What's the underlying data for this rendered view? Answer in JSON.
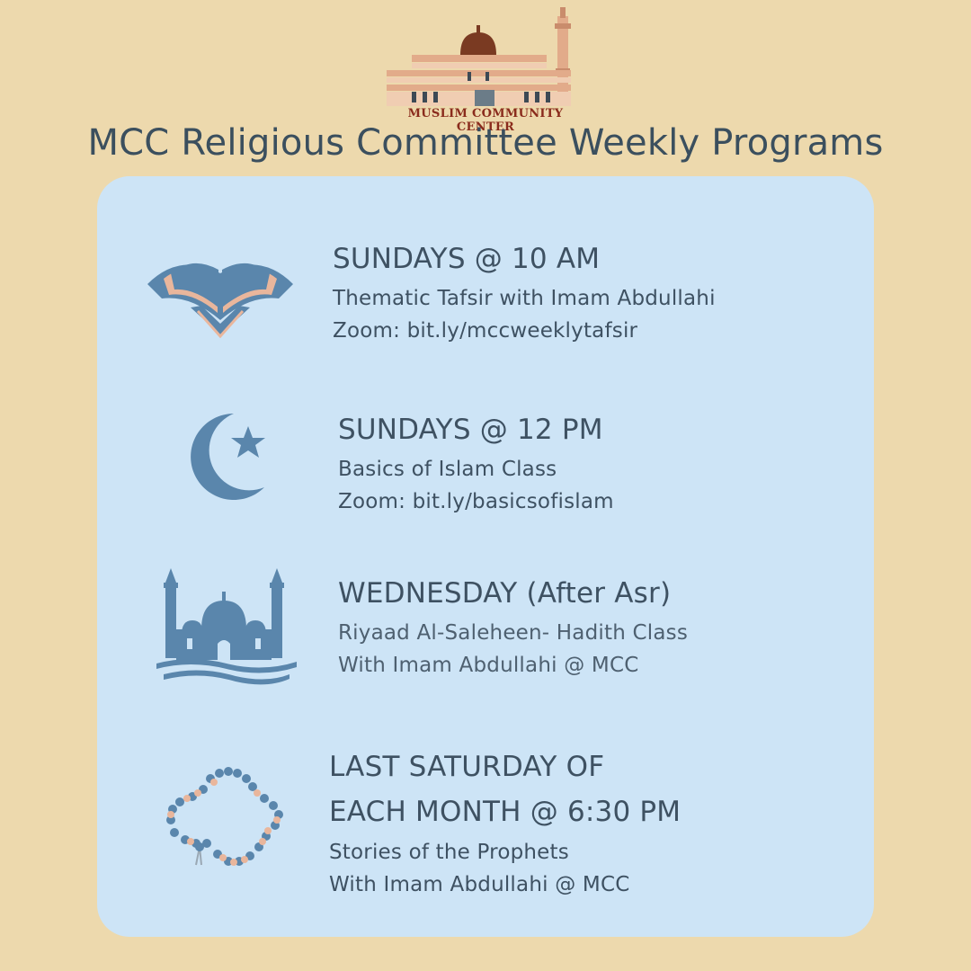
{
  "logo": {
    "name": "Muslim Community Center",
    "text": "MUSLIM COMMUNITY CENTER"
  },
  "title": "MCC Religious Committee Weekly Programs",
  "colors": {
    "background": "#edd9ad",
    "panel": "#cde4f6",
    "icon_blue": "#5a86ac",
    "accent_peach": "#e9b69c",
    "text": "#3e5162"
  },
  "programs": [
    {
      "icon": "quran-book-icon",
      "heading": "SUNDAYS @ 10 AM",
      "lines": [
        "Thematic Tafsir with Imam Abdullahi",
        "Zoom: bit.ly/mccweeklytafsir"
      ]
    },
    {
      "icon": "crescent-star-icon",
      "heading": "SUNDAYS @ 12 PM",
      "lines": [
        "Basics of Islam Class",
        "Zoom: bit.ly/basicsofislam"
      ]
    },
    {
      "icon": "mosque-icon",
      "heading": "WEDNESDAY (After Asr)",
      "lines": [
        "Riyaad Al-Saleheen- Hadith Class",
        "With Imam Abdullahi @ MCC"
      ]
    },
    {
      "icon": "prayer-beads-icon",
      "heading_line1": "LAST SATURDAY OF",
      "heading_line2": "EACH MONTH @ 6:30 PM",
      "lines": [
        "Stories of the Prophets",
        "With Imam Abdullahi @ MCC"
      ]
    }
  ]
}
